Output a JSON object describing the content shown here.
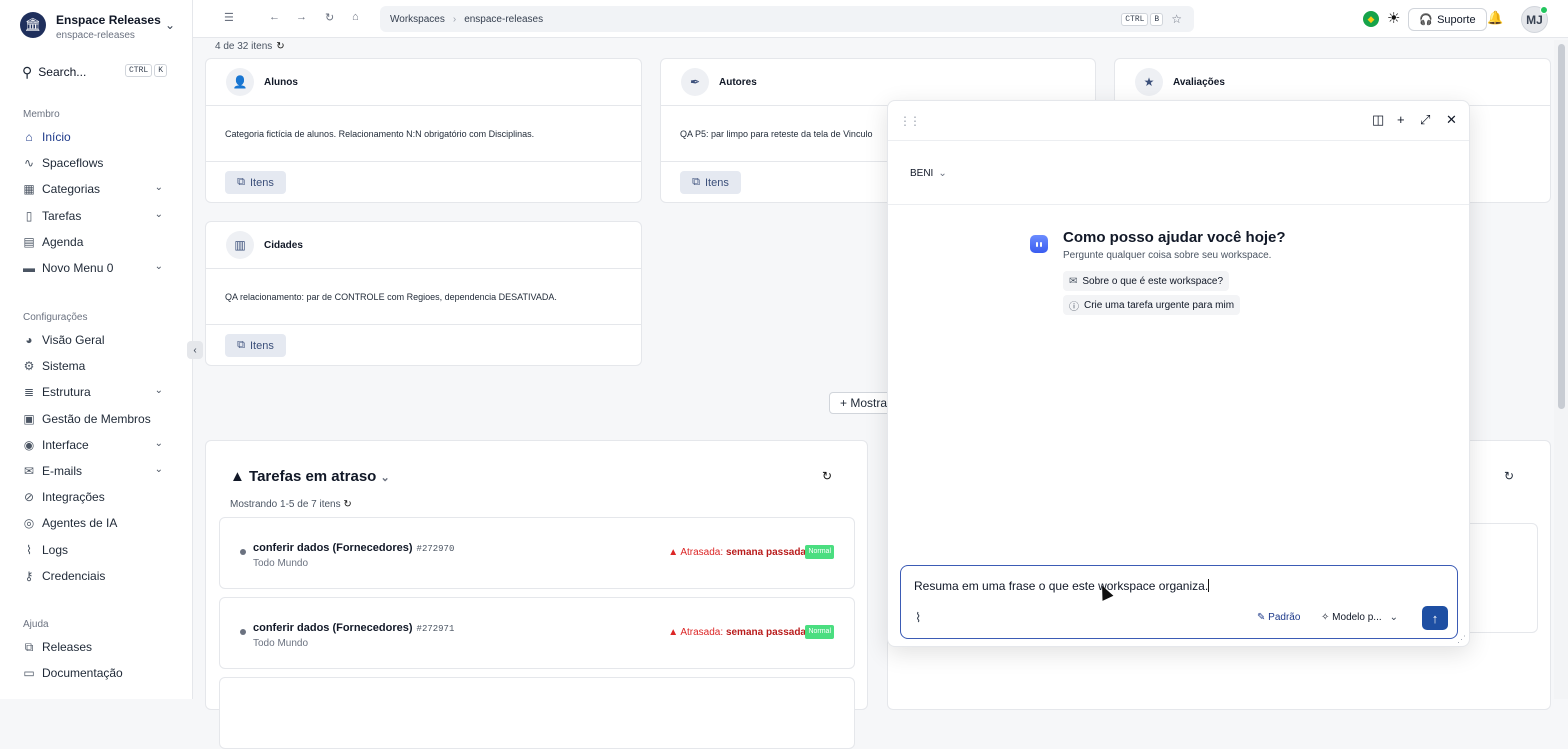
{
  "workspace": {
    "name": "Enspace Releases",
    "slug": "enspace-releases"
  },
  "search": {
    "label": "Search...",
    "kbd1": "CTRL",
    "kbd2": "K"
  },
  "sections": {
    "membro": "Membro",
    "config": "Configurações",
    "ajuda": "Ajuda"
  },
  "nav_membro": [
    {
      "label": "Início",
      "icon": "home-icon",
      "chev": false
    },
    {
      "label": "Spaceflows",
      "icon": "flow-icon",
      "chev": false
    },
    {
      "label": "Categorias",
      "icon": "grid-icon",
      "chev": true
    },
    {
      "label": "Tarefas",
      "icon": "file-icon",
      "chev": true
    },
    {
      "label": "Agenda",
      "icon": "calendar-icon",
      "chev": false
    },
    {
      "label": "Novo Menu 0",
      "icon": "menu-icon",
      "chev": true
    }
  ],
  "nav_config": [
    {
      "label": "Visão Geral",
      "icon": "pie-icon",
      "chev": false
    },
    {
      "label": "Sistema",
      "icon": "gear-icon",
      "chev": false
    },
    {
      "label": "Estrutura",
      "icon": "database-icon",
      "chev": true
    },
    {
      "label": "Gestão de Membros",
      "icon": "users-icon",
      "chev": false
    },
    {
      "label": "Interface",
      "icon": "palette-icon",
      "chev": true
    },
    {
      "label": "E-mails",
      "icon": "mail-icon",
      "chev": true
    },
    {
      "label": "Integrações",
      "icon": "link-icon",
      "chev": false
    },
    {
      "label": "Agentes de IA",
      "icon": "chip-icon",
      "chev": false
    },
    {
      "label": "Logs",
      "icon": "activity-icon",
      "chev": false
    },
    {
      "label": "Credenciais",
      "icon": "key-icon",
      "chev": false
    }
  ],
  "nav_ajuda": [
    {
      "label": "Releases",
      "icon": "copy-icon"
    },
    {
      "label": "Documentação",
      "icon": "book-icon"
    }
  ],
  "breadcrumb": {
    "first": "Workspaces",
    "second": "enspace-releases",
    "kbd1": "CTRL",
    "kbd2": "B"
  },
  "topbar": {
    "support": "Suporte",
    "avatar": "MJ"
  },
  "list": {
    "count": "4 de 32 itens"
  },
  "cards": [
    {
      "title": "Alunos",
      "desc": "Categoria fictícia de alunos. Relacionamento N:N obrigatório com Disciplinas.",
      "btn": "Itens"
    },
    {
      "title": "Autores",
      "desc": "QA P5: par limpo para reteste da tela de Vinculo",
      "btn": "Itens"
    },
    {
      "title": "Avaliações",
      "desc": "",
      "btn": ""
    },
    {
      "title": "Cidades",
      "desc": "QA relacionamento: par de CONTROLE com Regioes, dependencia DESATIVADA.",
      "btn": "Itens"
    }
  ],
  "more_button": "Mostra",
  "tasks_panel": {
    "title": "Tarefas em atraso",
    "subtitle": "Mostrando 1-5 de 7 itens"
  },
  "tasks": [
    {
      "name": "conferir dados (Fornecedores)",
      "id": "#272970",
      "owner": "Todo Mundo",
      "late_label": "Atrasada:",
      "late_when": "semana passada",
      "priority": "Normal"
    },
    {
      "name": "conferir dados (Fornecedores)",
      "id": "#272971",
      "owner": "Todo Mundo",
      "late_label": "Atrasada:",
      "late_when": "semana passada",
      "priority": "Normal"
    }
  ],
  "chat": {
    "agent": "BENI",
    "greeting": "Como posso ajudar você hoje?",
    "greeting_sub": "Pergunte qualquer coisa sobre seu workspace.",
    "suggestions": [
      "Sobre o que é este workspace?",
      "Crie uma tarefa urgente para mim"
    ],
    "input_value": "Resuma em uma frase o que este workspace organiza.",
    "mode": "Padrão",
    "model": "Modelo p..."
  }
}
